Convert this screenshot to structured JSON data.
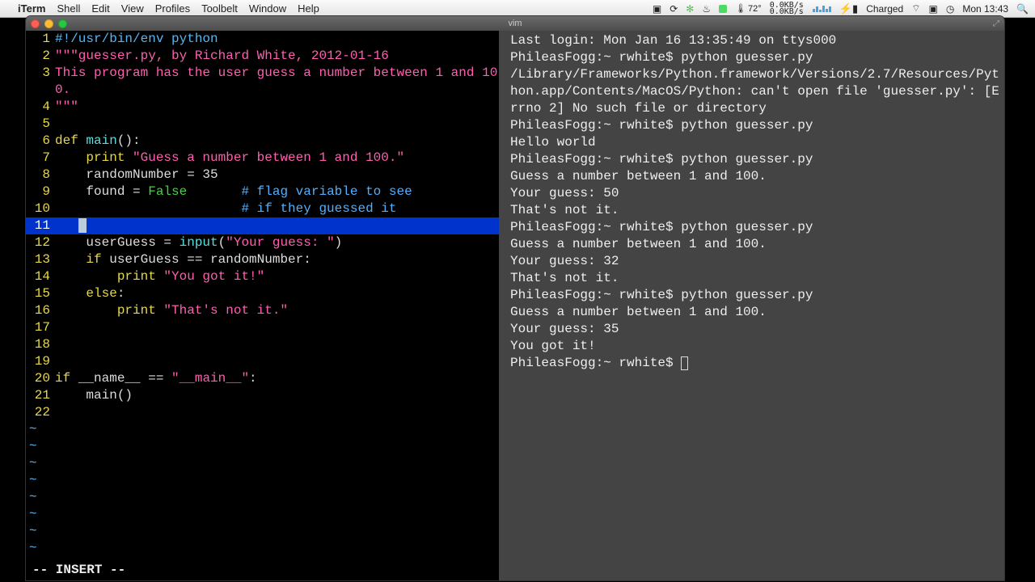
{
  "menubar": {
    "app": "iTerm",
    "items": [
      "Shell",
      "Edit",
      "View",
      "Profiles",
      "Toolbelt",
      "Window",
      "Help"
    ],
    "temp": "72°",
    "net_up": "0.0KB/s",
    "net_dn": "0.0KB/s",
    "charge": "Charged",
    "clock": "Mon 13:43"
  },
  "window": {
    "title": "vim"
  },
  "vim": {
    "lines": [
      {
        "n": "1",
        "seg": [
          {
            "t": "#!/usr/bin/env python",
            "c": "c-she"
          }
        ]
      },
      {
        "n": "2",
        "seg": [
          {
            "t": "\"\"\"guesser.py, by Richard White, 2012-01-16",
            "c": "c-str"
          }
        ]
      },
      {
        "n": "3",
        "seg": [
          {
            "t": "This program has the user guess a number between 1 and 100.",
            "c": "c-str"
          }
        ]
      },
      {
        "n": "4",
        "seg": [
          {
            "t": "\"\"\"",
            "c": "c-str"
          }
        ]
      },
      {
        "n": "5",
        "seg": [
          {
            "t": ""
          }
        ]
      },
      {
        "n": "6",
        "seg": [
          {
            "t": "def ",
            "c": "c-kw"
          },
          {
            "t": "main",
            "c": "c-fn"
          },
          {
            "t": "():"
          }
        ]
      },
      {
        "n": "7",
        "seg": [
          {
            "t": "    "
          },
          {
            "t": "print ",
            "c": "c-kw"
          },
          {
            "t": "\"Guess a number between 1 and 100.\"",
            "c": "c-str"
          }
        ]
      },
      {
        "n": "8",
        "seg": [
          {
            "t": "    randomNumber = 35"
          }
        ]
      },
      {
        "n": "9",
        "seg": [
          {
            "t": "    found = "
          },
          {
            "t": "False",
            "c": "c-bool"
          },
          {
            "t": "       "
          },
          {
            "t": "# flag variable to see",
            "c": "c-cmt"
          }
        ]
      },
      {
        "n": "10",
        "seg": [
          {
            "t": "                        "
          },
          {
            "t": "# if they guessed it",
            "c": "c-cmt"
          }
        ]
      },
      {
        "n": "11",
        "hl": true,
        "seg": [
          {
            "t": "   "
          }
        ],
        "cursor": true
      },
      {
        "n": "12",
        "seg": [
          {
            "t": "    userGuess = "
          },
          {
            "t": "input",
            "c": "c-fn"
          },
          {
            "t": "("
          },
          {
            "t": "\"Your guess: \"",
            "c": "c-str"
          },
          {
            "t": ")"
          }
        ]
      },
      {
        "n": "13",
        "seg": [
          {
            "t": "    "
          },
          {
            "t": "if",
            "c": "c-kw"
          },
          {
            "t": " userGuess == randomNumber:"
          }
        ]
      },
      {
        "n": "14",
        "seg": [
          {
            "t": "        "
          },
          {
            "t": "print ",
            "c": "c-kw"
          },
          {
            "t": "\"You got it!\"",
            "c": "c-str"
          }
        ]
      },
      {
        "n": "15",
        "seg": [
          {
            "t": "    "
          },
          {
            "t": "else",
            "c": "c-kw"
          },
          {
            "t": ":"
          }
        ]
      },
      {
        "n": "16",
        "seg": [
          {
            "t": "        "
          },
          {
            "t": "print ",
            "c": "c-kw"
          },
          {
            "t": "\"That's not it.\"",
            "c": "c-str"
          }
        ]
      },
      {
        "n": "17",
        "seg": [
          {
            "t": ""
          }
        ]
      },
      {
        "n": "18",
        "seg": [
          {
            "t": ""
          }
        ]
      },
      {
        "n": "19",
        "seg": [
          {
            "t": ""
          }
        ]
      },
      {
        "n": "20",
        "seg": [
          {
            "t": "if",
            "c": "c-kw"
          },
          {
            "t": " __name__ == "
          },
          {
            "t": "\"__main__\"",
            "c": "c-str"
          },
          {
            "t": ":"
          }
        ]
      },
      {
        "n": "21",
        "seg": [
          {
            "t": "    main()"
          }
        ]
      },
      {
        "n": "22",
        "seg": [
          {
            "t": ""
          }
        ]
      }
    ],
    "tilde_rows": 8,
    "status": "-- INSERT --"
  },
  "terminal": {
    "lines": [
      "Last login: Mon Jan 16 13:35:49 on ttys000",
      "PhileasFogg:~ rwhite$ python guesser.py",
      "/Library/Frameworks/Python.framework/Versions/2.7/Resources/Python.app/Contents/MacOS/Python: can't open file 'guesser.py': [Errno 2] No such file or directory",
      "PhileasFogg:~ rwhite$ python guesser.py",
      "Hello world",
      "PhileasFogg:~ rwhite$ python guesser.py",
      "Guess a number between 1 and 100.",
      "Your guess: 50",
      "That's not it.",
      "PhileasFogg:~ rwhite$ python guesser.py",
      "Guess a number between 1 and 100.",
      "Your guess: 32",
      "That's not it.",
      "PhileasFogg:~ rwhite$ python guesser.py",
      "Guess a number between 1 and 100.",
      "Your guess: 35",
      "You got it!",
      "PhileasFogg:~ rwhite$ "
    ]
  }
}
